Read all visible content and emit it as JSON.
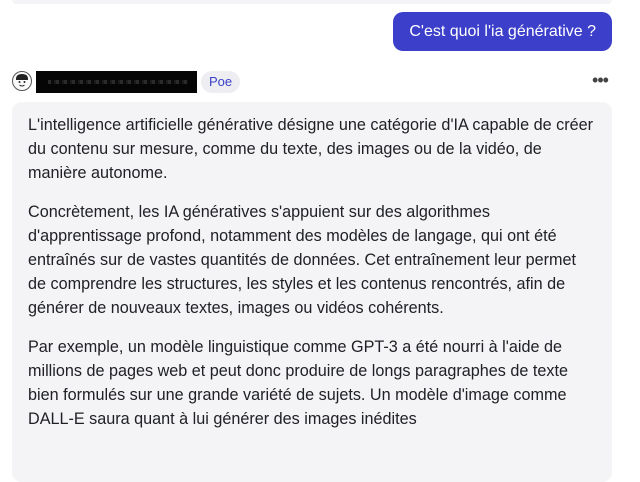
{
  "user_message": {
    "text": "C'est quoi l'ia générative ?"
  },
  "bot_header": {
    "badge": "Poe",
    "more_icon": "more-horizontal-icon",
    "avatar_icon": "avatar-icon"
  },
  "bot_message": {
    "paragraphs": [
      "L'intelligence artificielle générative désigne une catégorie d'IA capable de créer du contenu sur mesure, comme du texte, des images ou de la vidéo, de manière autonome.",
      "Concrètement, les IA génératives s'appuient sur des algorithmes d'apprentissage profond, notamment des modèles de langage, qui ont été entraînés sur de vastes quantités de données. Cet entraînement leur permet de comprendre les structures, les styles et les contenus rencontrés, afin de générer de nouveaux textes, images ou vidéos cohérents.",
      "Par exemple, un modèle linguistique comme GPT-3 a été nourri à l'aide de millions de pages web et peut donc produire de longs paragraphes de texte bien formulés sur une grande variété de sujets. Un modèle d'image comme DALL-E saura quant à lui générer des images inédites"
    ]
  },
  "colors": {
    "accent": "#3b3fc9",
    "bubble_bg": "#f4f4f6",
    "badge_bg": "#ededf2",
    "text": "#202124"
  }
}
